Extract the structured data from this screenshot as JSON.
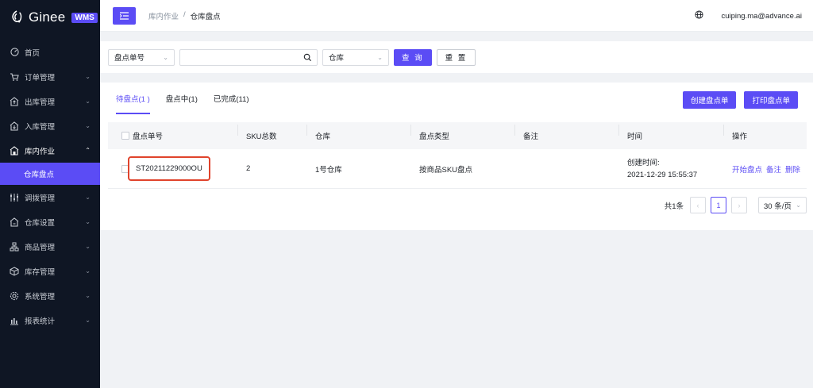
{
  "brand": {
    "name": "Ginee",
    "badge": "WMS"
  },
  "sidebar": {
    "items": [
      {
        "label": "首页",
        "icon": "dashboard-icon",
        "chevron": false
      },
      {
        "label": "订单管理",
        "icon": "cart-icon",
        "chevron": true
      },
      {
        "label": "出库管理",
        "icon": "outbound-icon",
        "chevron": true
      },
      {
        "label": "入库管理",
        "icon": "inbound-icon",
        "chevron": true
      },
      {
        "label": "库内作业",
        "icon": "warehouse-op-icon",
        "chevron": true,
        "expanded": true
      },
      {
        "label": "调拨管理",
        "icon": "transfer-icon",
        "chevron": true
      },
      {
        "label": "仓库设置",
        "icon": "warehouse-settings-icon",
        "chevron": true
      },
      {
        "label": "商品管理",
        "icon": "product-icon",
        "chevron": true
      },
      {
        "label": "库存管理",
        "icon": "inventory-icon",
        "chevron": true
      },
      {
        "label": "系统管理",
        "icon": "gear-icon",
        "chevron": true
      },
      {
        "label": "报表统计",
        "icon": "bar-chart-icon",
        "chevron": true
      }
    ],
    "active_sub": "仓库盘点"
  },
  "header": {
    "breadcrumb_parent": "库内作业",
    "breadcrumb_sep": "/",
    "breadcrumb_current": "仓库盘点",
    "user_email": "cuiping.ma@advance.ai"
  },
  "filter": {
    "field_select": "盘点单号",
    "search_value": "",
    "warehouse_select": "仓库",
    "query_label": "查 询",
    "reset_label": "重 置"
  },
  "tabs": [
    {
      "label": "待盘点(1 )",
      "active": true
    },
    {
      "label": "盘点中(1)",
      "active": false
    },
    {
      "label": "已完成(11)",
      "active": false
    }
  ],
  "actions": {
    "create_label": "创建盘点单",
    "print_label": "打印盘点单"
  },
  "table": {
    "headers": {
      "no": "盘点单号",
      "sku": "SKU总数",
      "warehouse": "仓库",
      "type": "盘点类型",
      "note": "备注",
      "time": "时间",
      "op": "操作"
    },
    "rows": [
      {
        "no": "ST20211229000OU",
        "sku": "2",
        "warehouse": "1号仓库",
        "type": "按商品SKU盘点",
        "note": "",
        "time_label": "创建时间:",
        "time_value": "2021-12-29 15:55:37",
        "op_start": "开始盘点",
        "op_note": "备注",
        "op_delete": "删除"
      }
    ]
  },
  "pager": {
    "total": "共1条",
    "current": "1",
    "page_size": "30 条/页"
  },
  "colors": {
    "accent": "#5b4cf5",
    "sidebar_bg": "#0f1624",
    "highlight": "#e0432c"
  }
}
